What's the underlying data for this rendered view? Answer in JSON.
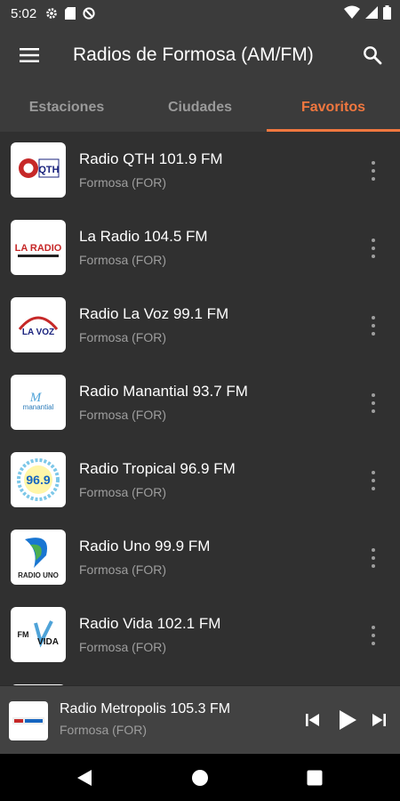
{
  "status_bar": {
    "time": "5:02",
    "left_icons": [
      "gear-icon",
      "sd-card-icon",
      "no-entry-icon"
    ],
    "right_icons": [
      "wifi-icon",
      "cell-signal-icon",
      "battery-icon"
    ]
  },
  "app_bar": {
    "title": "Radios de Formosa (AM/FM)",
    "menu_icon": "hamburger-menu-icon",
    "search_icon": "search-icon"
  },
  "tabs": [
    {
      "label": "Estaciones",
      "active": false
    },
    {
      "label": "Ciudades",
      "active": false
    },
    {
      "label": "Favoritos",
      "active": true
    }
  ],
  "accent_color": "#f0773f",
  "stations": [
    {
      "name": "Radio QTH 101.9 FM",
      "location": "Formosa (FOR)",
      "logo_text": "QTH"
    },
    {
      "name": "La Radio 104.5 FM",
      "location": "Formosa (FOR)",
      "logo_text": "LA RADIO"
    },
    {
      "name": "Radio La Voz 99.1 FM",
      "location": "Formosa (FOR)",
      "logo_text": "LA VOZ"
    },
    {
      "name": "Radio Manantial 93.7 FM",
      "location": "Formosa (FOR)",
      "logo_text": "manantial"
    },
    {
      "name": "Radio Tropical 96.9 FM",
      "location": "Formosa (FOR)",
      "logo_text": "96.9"
    },
    {
      "name": "Radio Uno 99.9 FM",
      "location": "Formosa (FOR)",
      "logo_text": "RADIO UNO"
    },
    {
      "name": "Radio Vida 102.1 FM",
      "location": "Formosa (FOR)",
      "logo_text": "VIDA"
    }
  ],
  "now_playing": {
    "title": "Radio Metropolis 105.3 FM",
    "location": "Formosa (FOR)",
    "controls": [
      "skip-previous-icon",
      "play-icon",
      "skip-next-icon"
    ]
  },
  "nav_bar": [
    "back-icon",
    "home-icon",
    "recents-icon"
  ]
}
